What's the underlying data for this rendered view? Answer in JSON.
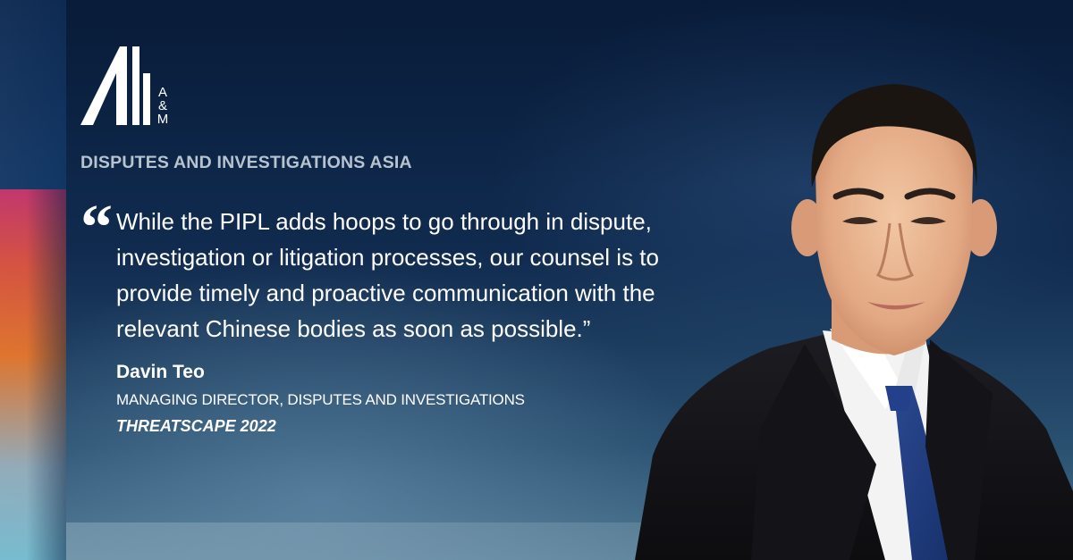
{
  "brand": {
    "logo_letters": [
      "A",
      "&",
      "M"
    ],
    "section_title": "DISPUTES AND INVESTIGATIONS ASIA"
  },
  "quote": {
    "mark": "“",
    "lines": [
      "While the PIPL adds hoops to go through in dispute,",
      "investigation or litigation processes, our counsel is to",
      "provide timely and proactive communication with the",
      "relevant Chinese bodies as soon as possible.”"
    ]
  },
  "attribution": {
    "name": "Davin Teo",
    "role": "MANAGING DIRECTOR, DISPUTES AND INVESTIGATIONS",
    "event": "THREATSCAPE 2022"
  },
  "colors": {
    "background": "#0b2344",
    "section_title": "#b7c3cf",
    "text": "#ffffff",
    "accent_pink": "#d1376f",
    "accent_orange": "#ef7a2a",
    "accent_teal": "#7fc6d8"
  },
  "icons": {
    "logo": "am-logo-icon",
    "quote": "quote-mark-icon",
    "portrait": "portrait-photo"
  }
}
